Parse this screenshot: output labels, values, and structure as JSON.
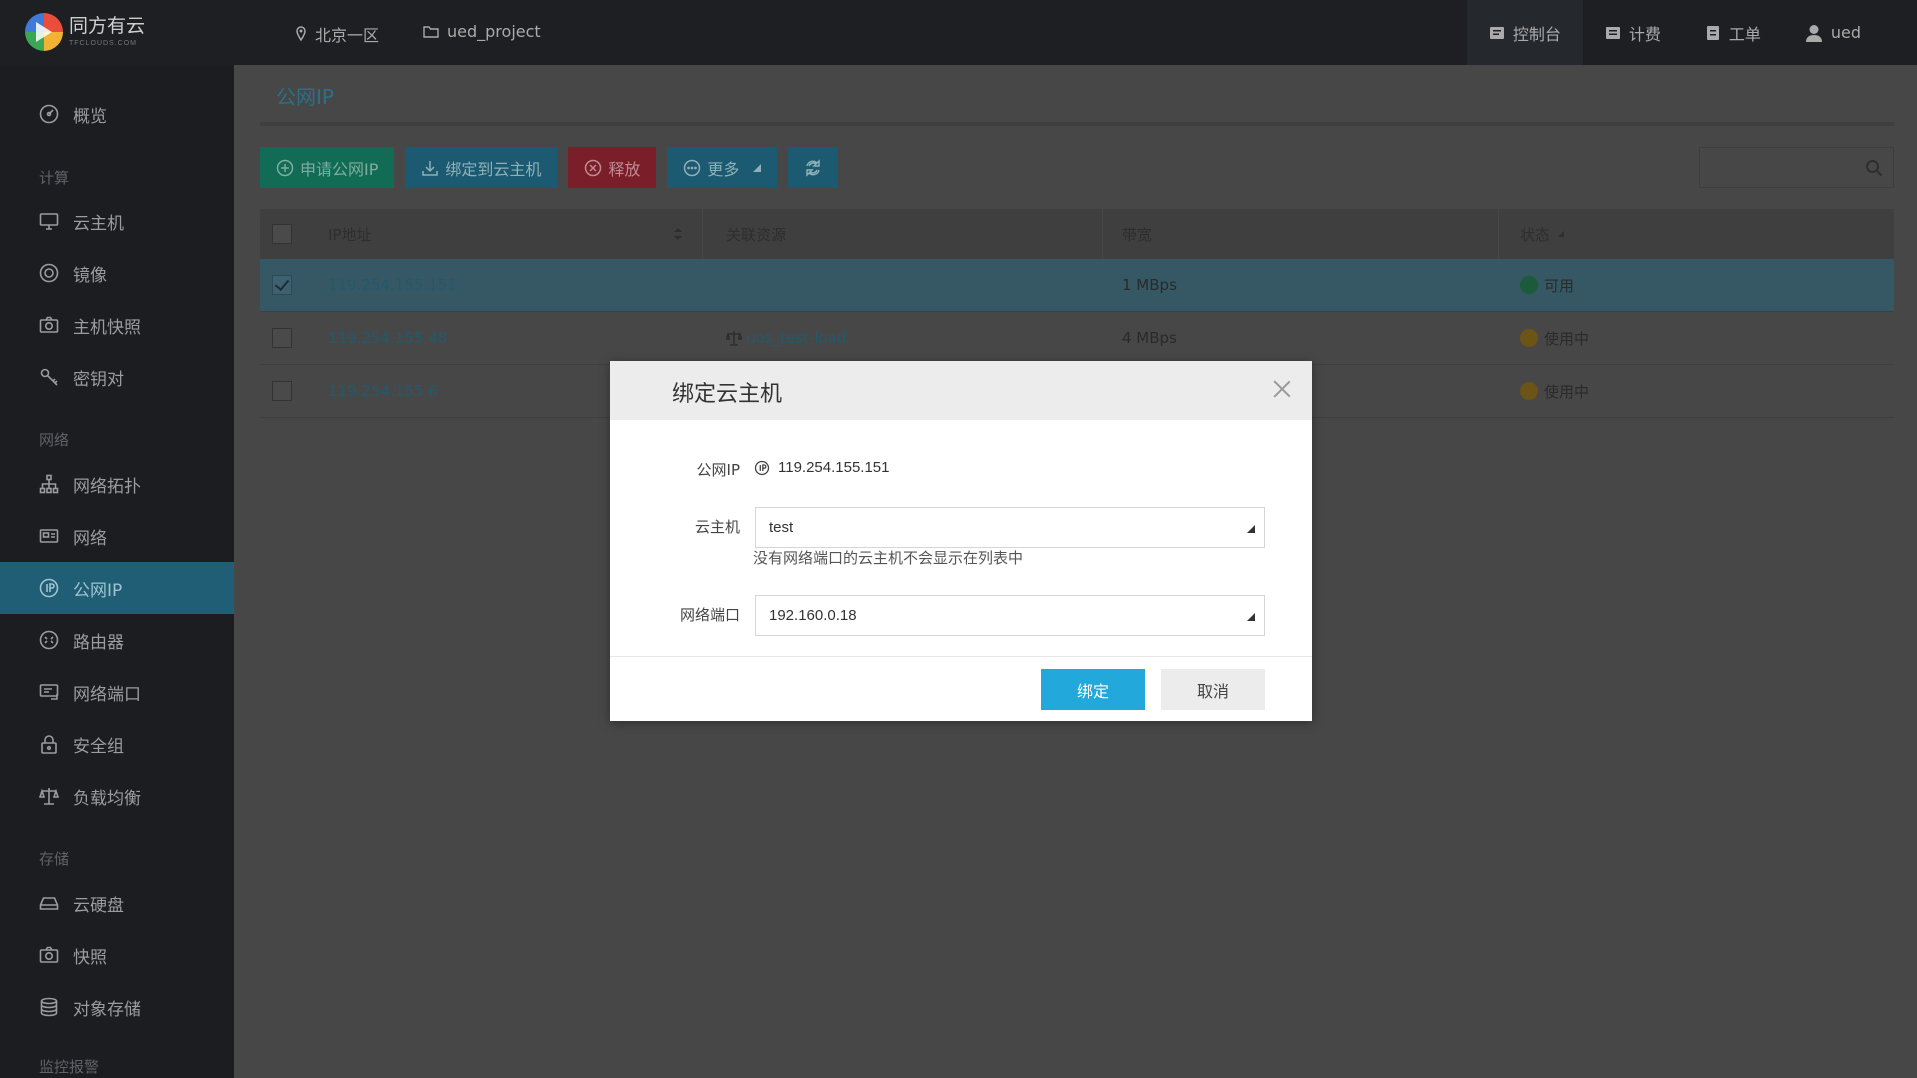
{
  "app": {
    "logo_text": "同方有云",
    "logo_sub": "TFCLOUDS.COM",
    "region": "北京一区",
    "project": "ued_project"
  },
  "topnav": [
    {
      "label": "控制台",
      "icon": "console-icon"
    },
    {
      "label": "计费",
      "icon": "billing-icon"
    },
    {
      "label": "工单",
      "icon": "ticket-icon"
    },
    {
      "label": "ued",
      "icon": "user-icon"
    }
  ],
  "sidebar": {
    "groups": {
      "compute": "计算",
      "network": "网络",
      "storage": "存储",
      "monitor": "监控报警"
    },
    "items": {
      "overview": "概览",
      "instances": "云主机",
      "images": "镜像",
      "snapshots_host": "主机快照",
      "keypairs": "密钥对",
      "topology": "网络拓扑",
      "networks": "网络",
      "public_ip": "公网IP",
      "routers": "路由器",
      "ports": "网络端口",
      "security_groups": "安全组",
      "load_balancer": "负载均衡",
      "volumes": "云硬盘",
      "snapshots": "快照",
      "object_storage": "对象存储"
    }
  },
  "page": {
    "title": "公网IP",
    "toolbar": {
      "apply": "申请公网IP",
      "bind": "绑定到云主机",
      "release": "释放",
      "more": "更多"
    },
    "table": {
      "headers": {
        "ip": "IP地址",
        "resource": "关联资源",
        "bandwidth": "带宽",
        "status": "状态"
      },
      "rows": [
        {
          "ip": "119.254.155.151",
          "resource": "",
          "bandwidth": "1 MBps",
          "status": "可用",
          "selected": true
        },
        {
          "ip": "119.254.155.48",
          "resource": "uos_test-load",
          "bandwidth": "4 MBps",
          "status": "使用中",
          "selected": false
        },
        {
          "ip": "119.254.155.6",
          "resource": "",
          "bandwidth": "",
          "status": "使用中",
          "selected": false
        }
      ]
    }
  },
  "modal": {
    "title": "绑定云主机",
    "ip_label": "公网IP",
    "ip_value": "119.254.155.151",
    "instance_label": "云主机",
    "instance_value": "test",
    "hint": "没有网络端口的云主机不会显示在列表中",
    "port_label": "网络端口",
    "port_value": "192.160.0.18",
    "ok": "绑定",
    "cancel": "取消"
  },
  "colors": {
    "accent": "#22a8da",
    "status_available": "#2bb673",
    "status_in_use": "#f0b41e"
  }
}
